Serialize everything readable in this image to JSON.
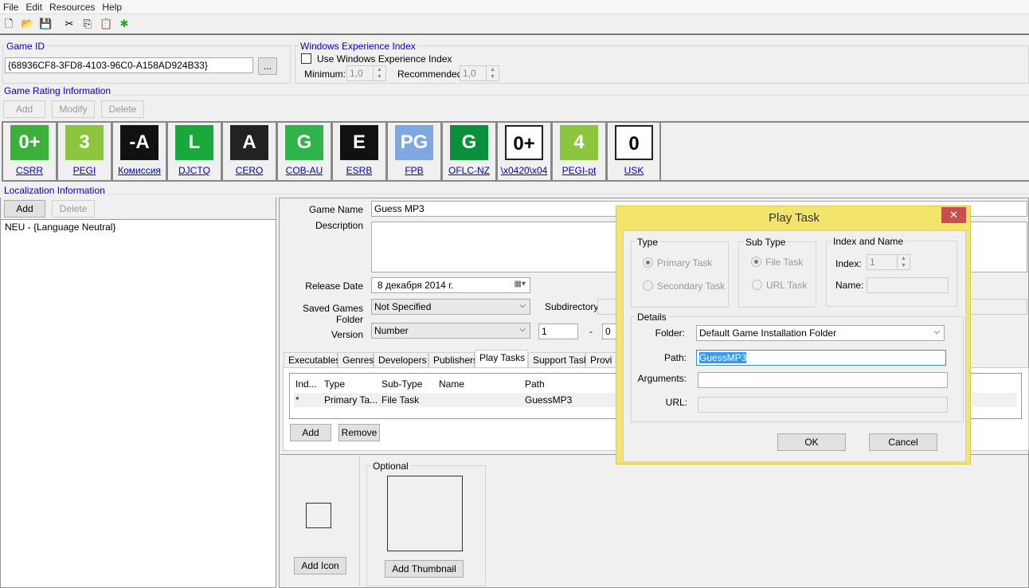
{
  "menu": [
    "File",
    "Edit",
    "Resources",
    "Help"
  ],
  "toolbar": [
    "new-file-icon",
    "open-folder-icon",
    "save-icon",
    "cut-icon",
    "copy-icon",
    "paste-icon",
    "bug-icon"
  ],
  "game_id": {
    "legend": "Game ID",
    "value": "{68936CF8-3FD8-4103-96C0-A158AD924B33}",
    "browse": "..."
  },
  "wei": {
    "legend": "Windows Experience Index",
    "checkbox": "Use Windows Experience Index",
    "checked": false,
    "min_label": "Minimum:",
    "min": "1,0",
    "rec_label": "Recommended:",
    "rec": "1,0"
  },
  "rating": {
    "legend": "Game Rating Information",
    "add": "Add",
    "modify": "Modify",
    "delete": "Delete",
    "items": [
      {
        "name": "CSRR",
        "logo": "0+",
        "color": "#3bb03b"
      },
      {
        "name": "PEGI",
        "logo": "3",
        "color": "#8cc63f"
      },
      {
        "name": "Комиссия",
        "logo": "-A",
        "color": "#111111"
      },
      {
        "name": "DJCTQ",
        "logo": "L",
        "color": "#1aa83a"
      },
      {
        "name": "CERO",
        "logo": "A",
        "color": "#222222"
      },
      {
        "name": "COB-AU",
        "logo": "G",
        "color": "#2fb34a"
      },
      {
        "name": "ESRB",
        "logo": "E",
        "color": "#111111"
      },
      {
        "name": "FPB",
        "logo": "PG",
        "color": "#7fa7e0"
      },
      {
        "name": "OFLC-NZ",
        "logo": "G",
        "color": "#0a8f3a"
      },
      {
        "name": "\\x0420\\x04",
        "logo": "0+",
        "color": "#ffffff"
      },
      {
        "name": "PEGI-pt",
        "logo": "4",
        "color": "#8cc63f"
      },
      {
        "name": "USK",
        "logo": "0",
        "color": "#ffffff"
      }
    ]
  },
  "localization": {
    "legend": "Localization Information",
    "add": "Add",
    "delete": "Delete",
    "items": [
      "NEU - {Language Neutral}"
    ]
  },
  "form": {
    "game_name_label": "Game Name",
    "game_name": "Guess MP3",
    "description_label": "Description",
    "description": "",
    "release_label": "Release Date",
    "release": "8  декабря  2014 г.",
    "saved_label": "Saved Games Folder",
    "saved": "Not Specified",
    "subdir_label": "Subdirectory",
    "version_label": "Version",
    "version": "Number",
    "v1": "1",
    "sep": "-",
    "v2": "0"
  },
  "tabs": [
    "Executables",
    "Genres",
    "Developers",
    "Publishers",
    "Play Tasks",
    "Support Tasks",
    "Provi"
  ],
  "active_tab": "Play Tasks",
  "table": {
    "headers": [
      "Ind...",
      "Type",
      "Sub-Type",
      "Name",
      "Path"
    ],
    "rows": [
      [
        "*",
        "Primary Ta...",
        "File Task",
        "",
        "GuessMP3"
      ]
    ],
    "add": "Add",
    "remove": "Remove"
  },
  "media": {
    "add_icon": "Add Icon",
    "optional": "Optional",
    "add_thumb": "Add Thumbnail"
  },
  "dialog": {
    "title": "Play Task",
    "type_legend": "Type",
    "primary": "Primary Task",
    "secondary": "Secondary Task",
    "subtype_legend": "Sub Type",
    "file": "File Task",
    "url_task": "URL Task",
    "index_legend": "Index and Name",
    "index_label": "Index:",
    "index": "1",
    "name_label": "Name:",
    "name": "",
    "details_legend": "Details",
    "folder_label": "Folder:",
    "folder": "Default Game Installation Folder",
    "path_label": "Path:",
    "path": "GuessMP3",
    "args_label": "Arguments:",
    "args": "",
    "url_label": "URL:",
    "url": "",
    "ok": "OK",
    "cancel": "Cancel",
    "frame_color": "#f3e56b",
    "close_color": "#c94f4f"
  }
}
